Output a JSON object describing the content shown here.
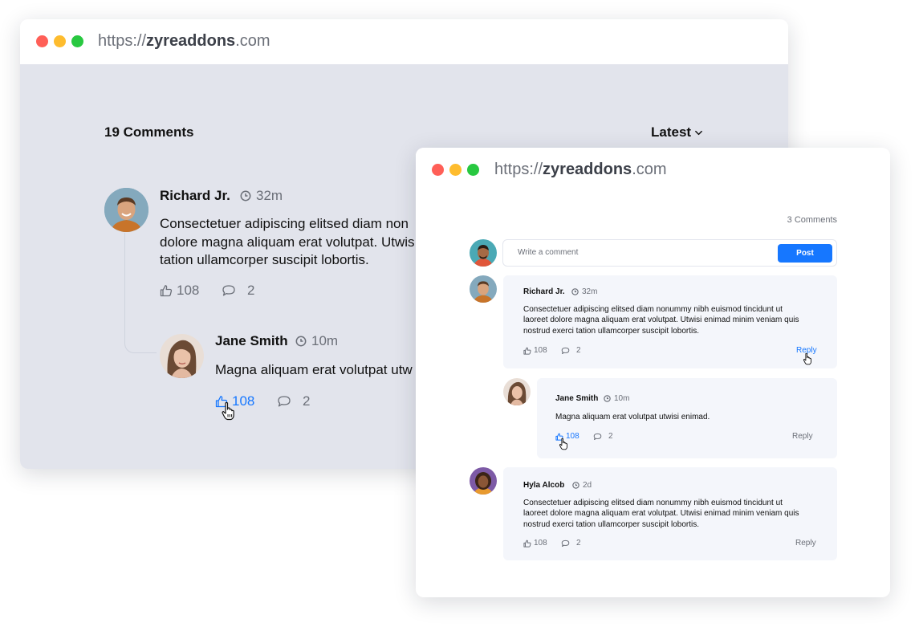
{
  "browser": {
    "url_prefix": "https://",
    "url_domain": "zyreaddons",
    "url_suffix": ".com"
  },
  "back": {
    "comments_count": "19 Comments",
    "sort_label": "Latest",
    "comment1": {
      "author": "Richard Jr.",
      "time": "32m",
      "text_lines": [
        "Consectetuer adipiscing elitsed diam non",
        "dolore magna aliquam erat volutpat. Utwis",
        "tation ullamcorper suscipit lobortis."
      ],
      "likes": "108",
      "replies": "2"
    },
    "comment2": {
      "author": "Jane Smith",
      "time": "10m",
      "text": "Magna aliquam erat volutpat utw",
      "likes": "108",
      "replies": "2"
    }
  },
  "front": {
    "comments_count": "3 Comments",
    "compose_placeholder": "Write a comment",
    "post_label": "Post",
    "comments": [
      {
        "author": "Richard Jr.",
        "time": "32m",
        "text_lines": [
          "Consectetuer adipiscing elitsed diam nonummy nibh euismod tincidunt ut",
          "laoreet dolore magna aliquam erat volutpat. Utwisi enimad minim veniam quis",
          "nostrud exerci tation ullamcorper suscipit lobortis."
        ],
        "likes": "108",
        "replies": "2",
        "reply_label": "Reply"
      },
      {
        "author": "Jane Smith",
        "time": "10m",
        "text_lines": [
          "Magna aliquam erat volutpat utwisi enimad."
        ],
        "likes": "108",
        "replies": "2",
        "reply_label": "Reply"
      },
      {
        "author": "Hyla Alcob",
        "time": "2d",
        "text_lines": [
          "Consectetuer adipiscing elitsed diam nonummy nibh euismod tincidunt ut",
          "laoreet dolore magna aliquam erat volutpat. Utwisi enimad minim veniam quis",
          "nostrud exerci tation ullamcorper suscipit lobortis."
        ],
        "likes": "108",
        "replies": "2",
        "reply_label": "Reply"
      }
    ]
  },
  "colors": {
    "accent": "#1677ff",
    "traffic_red": "#ff5f57",
    "traffic_yellow": "#febc2e",
    "traffic_green": "#28c840",
    "back_bg": "#e2e4ec",
    "card_bg": "#f4f6fb"
  }
}
